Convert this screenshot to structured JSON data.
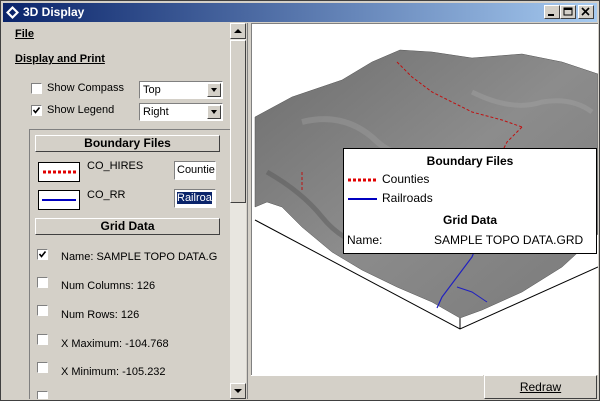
{
  "window": {
    "title": "3D Display"
  },
  "menu": {
    "file": "File"
  },
  "display_print": {
    "header": "Display and Print",
    "show_compass": {
      "label": "Show Compass",
      "checked": false,
      "value": "Top"
    },
    "show_legend": {
      "label": "Show Legend",
      "checked": true,
      "value": "Right"
    }
  },
  "boundary_files": {
    "header": "Boundary Files",
    "items": [
      {
        "name": "CO_HIRES",
        "field": "Countie",
        "color": "#e00000",
        "style": "dotted"
      },
      {
        "name": "CO_RR",
        "field": "Railroa",
        "color": "#0000c0",
        "style": "solid"
      }
    ]
  },
  "grid_data": {
    "header": "Grid Data",
    "rows": [
      {
        "label": "Name: SAMPLE TOPO DATA.G",
        "checked": true
      },
      {
        "label": "Num Columns: 126",
        "checked": false
      },
      {
        "label": "Num Rows: 126",
        "checked": false
      },
      {
        "label": "X Maximum: -104.768",
        "checked": false
      },
      {
        "label": "X Minimum: -105.232",
        "checked": false
      }
    ]
  },
  "legend": {
    "boundary_title": "Boundary Files",
    "items": [
      {
        "label": "Counties"
      },
      {
        "label": "Railroads"
      }
    ],
    "grid_title": "Grid Data",
    "name_label": "Name:",
    "name_value": "SAMPLE TOPO DATA.GRD"
  },
  "buttons": {
    "redraw": "Redraw"
  }
}
